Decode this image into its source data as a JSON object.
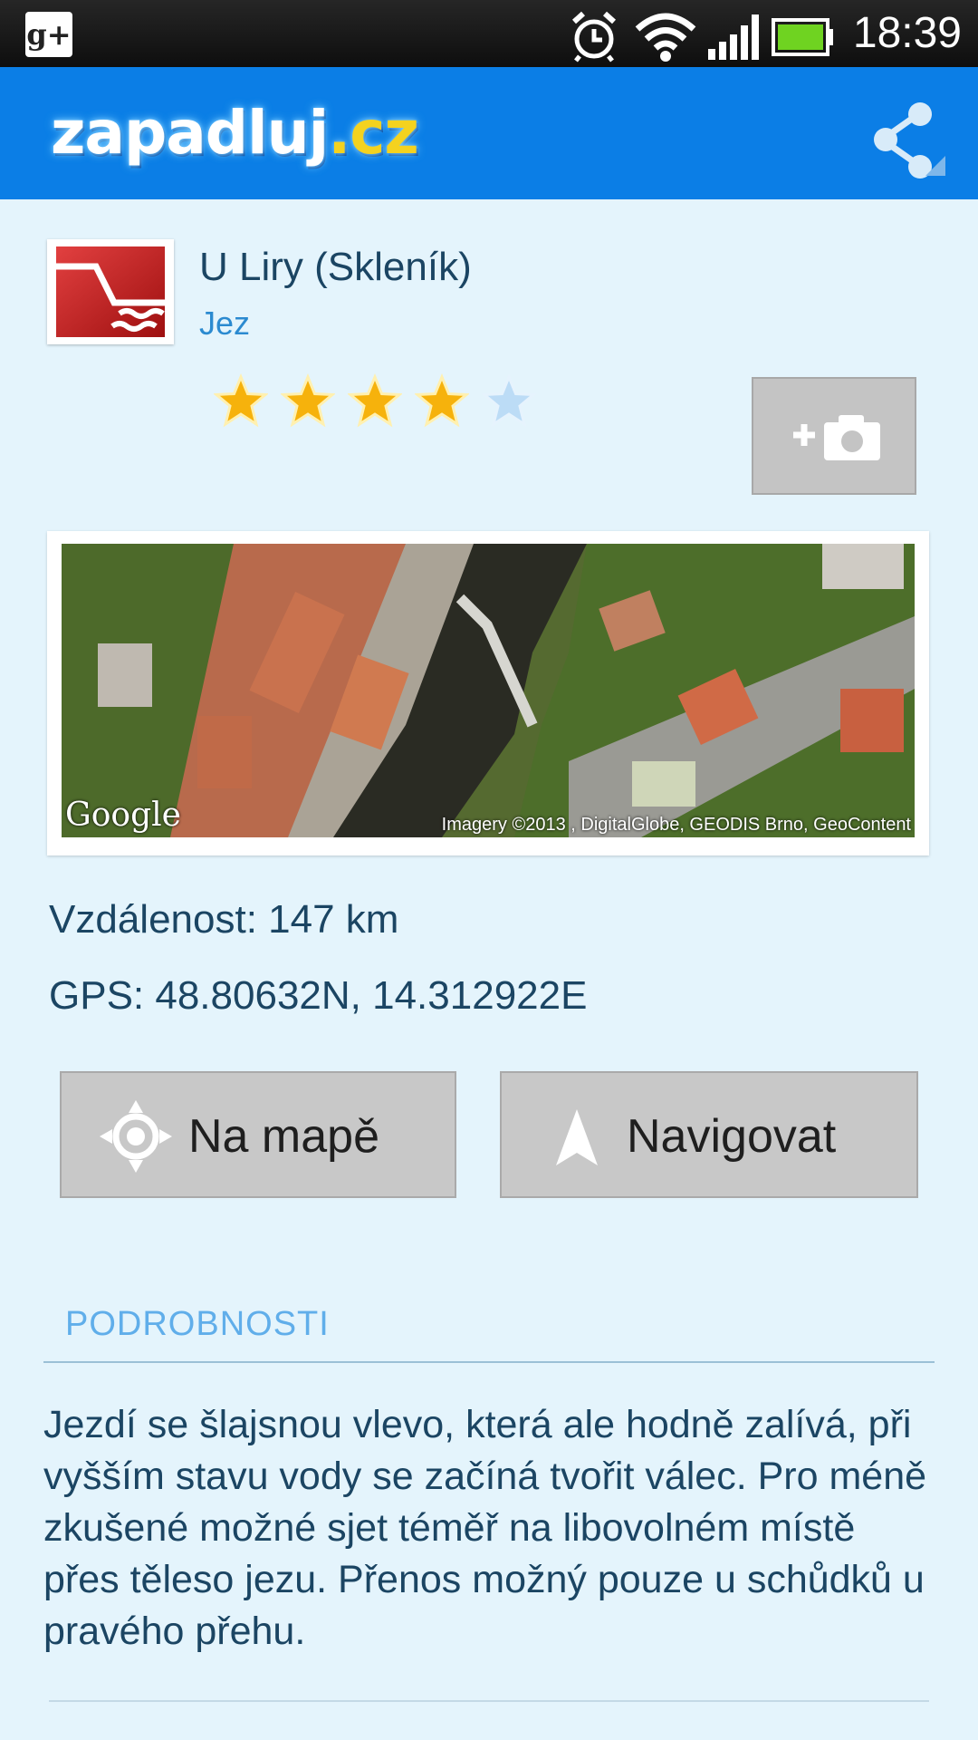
{
  "statusbar": {
    "time": "18:39",
    "icons": [
      "google-plus-icon",
      "alarm-icon",
      "wifi-icon",
      "signal-icon",
      "battery-icon"
    ]
  },
  "actionbar": {
    "logo_main": "zapadluj",
    "logo_tld": ".cz",
    "share_icon": "share-icon"
  },
  "place": {
    "title": "U Liry (Skleník)",
    "type": "Jez",
    "rating": 4,
    "rating_max": 5
  },
  "map": {
    "brand": "Google",
    "credit": "Imagery ©2013 , DigitalGlobe, GEODIS Brno, GeoContent"
  },
  "info": {
    "distance": "Vzdálenost: 147 km",
    "gps": "GPS: 48.80632N, 14.312922E"
  },
  "buttons": {
    "map": "Na mapě",
    "navigate": "Navigovat"
  },
  "details": {
    "heading": "PODROBNOSTI",
    "text": "Jezdí se šlajsnou vlevo, která ale hodně zalívá, při vyšším stavu vody se začíná tvořit válec. Pro méně zkušené možné sjet téměř na libovolném místě přes těleso jezu. Přenos možný pouze u schůdků u pravého přehu."
  },
  "colors": {
    "actionbar": "#0b7ee6",
    "background": "#e4f4fc",
    "text": "#1b4563",
    "accent": "#2b8ad0"
  }
}
